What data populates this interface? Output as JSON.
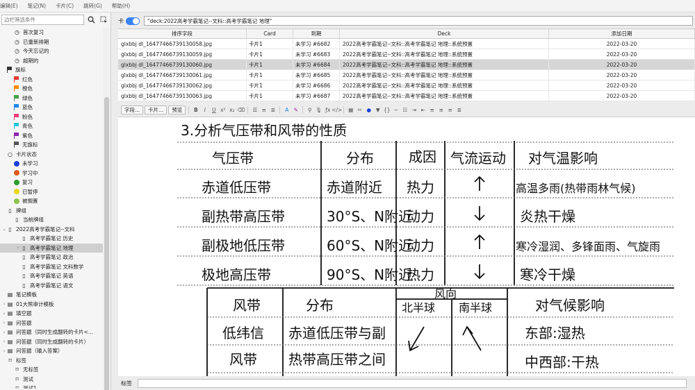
{
  "menu": [
    "编辑(E)",
    "笔记(N)",
    "卡片(C)",
    "跳转(G)",
    "帮助(H)"
  ],
  "sidebar": {
    "search_placeholder": "边栏筛选条件",
    "items": [
      {
        "label": "首次复习",
        "icon": "clock-icon",
        "indent": 1
      },
      {
        "label": "已重新排期",
        "icon": "clock-icon",
        "indent": 1
      },
      {
        "label": "今天忘记的",
        "icon": "clock-icon",
        "indent": 1
      },
      {
        "label": "超期的",
        "icon": "clock-icon",
        "indent": 1
      },
      {
        "label": "旗标",
        "icon": "flag-icon",
        "indent": 0,
        "color": "#333333"
      },
      {
        "label": "红色",
        "icon": "flag-icon",
        "indent": 1,
        "color": "#e53935"
      },
      {
        "label": "橙色",
        "icon": "flag-icon",
        "indent": 1,
        "color": "#fb8c00"
      },
      {
        "label": "绿色",
        "icon": "flag-icon",
        "indent": 1,
        "color": "#43a047"
      },
      {
        "label": "蓝色",
        "icon": "flag-icon",
        "indent": 1,
        "color": "#1e88e5"
      },
      {
        "label": "粉色",
        "icon": "flag-icon",
        "indent": 1,
        "color": "#ec407a"
      },
      {
        "label": "青色",
        "icon": "flag-icon",
        "indent": 1,
        "color": "#26c6da"
      },
      {
        "label": "紫色",
        "icon": "flag-icon",
        "indent": 1,
        "color": "#8e24aa"
      },
      {
        "label": "无旗标",
        "icon": "flag-icon",
        "indent": 1,
        "color": "#555555"
      },
      {
        "label": "卡片状态",
        "icon": "circle-icon",
        "indent": 0
      },
      {
        "label": "未学习",
        "icon": "dot-icon",
        "indent": 1,
        "color": "#1a3fd6"
      },
      {
        "label": "学习中",
        "icon": "dot-icon",
        "indent": 1,
        "color": "#e0581b"
      },
      {
        "label": "复习",
        "icon": "dot-icon",
        "indent": 1,
        "color": "#2e9a2e"
      },
      {
        "label": "已暂停",
        "icon": "dot-icon",
        "indent": 1,
        "color": "#e3d81a"
      },
      {
        "label": "被搁置",
        "icon": "dot-icon",
        "indent": 1,
        "color": "#8bc34a"
      },
      {
        "label": "牌组",
        "icon": "deck-icon",
        "indent": 0
      },
      {
        "label": "当前牌组",
        "icon": "deck-icon",
        "indent": 1
      },
      {
        "label": "2022高考学霸笔记--文科",
        "icon": "deck-icon",
        "indent": 0,
        "arrow": "⌄"
      },
      {
        "label": "高考学霸笔记 历史",
        "icon": "deck-icon",
        "indent": 2
      },
      {
        "label": "高考学霸笔记 地理",
        "icon": "deck-icon",
        "indent": 2,
        "arrow": "›",
        "selected": true
      },
      {
        "label": "高考学霸笔记 政治",
        "icon": "deck-icon",
        "indent": 2
      },
      {
        "label": "高考学霸笔记 文科数学",
        "icon": "deck-icon",
        "indent": 2
      },
      {
        "label": "高考学霸笔记 英语",
        "icon": "deck-icon",
        "indent": 2
      },
      {
        "label": "高考学霸笔记 语文",
        "icon": "deck-icon",
        "indent": 2
      },
      {
        "label": "笔记模板",
        "icon": "notetype-icon",
        "indent": 0
      },
      {
        "label": "01大熊审计模板",
        "icon": "notetype-icon",
        "indent": 0,
        "arrow": "›"
      },
      {
        "label": "填空题",
        "icon": "notetype-icon",
        "indent": 0,
        "arrow": "›"
      },
      {
        "label": "问答题",
        "icon": "notetype-icon",
        "indent": 0,
        "arrow": "›"
      },
      {
        "label": "问答题（同时生成翻转的卡片<…",
        "icon": "notetype-icon",
        "indent": 0,
        "arrow": "›"
      },
      {
        "label": "问答题（同时生成翻转的卡片）",
        "icon": "notetype-icon",
        "indent": 0,
        "arrow": "›"
      },
      {
        "label": "问答题（输入答案）",
        "icon": "notetype-icon",
        "indent": 0,
        "arrow": "›"
      },
      {
        "label": "标签",
        "icon": "tag-icon",
        "indent": 0
      },
      {
        "label": "无标签",
        "icon": "tag-icon",
        "indent": 1
      },
      {
        "label": "测试",
        "icon": "tag-icon",
        "indent": 1
      },
      {
        "label": "测试1",
        "icon": "tag-icon",
        "indent": 1
      }
    ]
  },
  "search": {
    "toggle_label": "卡",
    "query": "\"deck:2022高考学霸笔记--文科::高考学霸笔记 地理\""
  },
  "table": {
    "headers": [
      "排序字段",
      "Card",
      "到期",
      "Deck",
      "添加日期"
    ],
    "rows": [
      [
        "glxbbj dl_16477466739130058.jpg",
        "卡片1",
        "未学习 #6682",
        "2022高考学霸笔记--文科::高考学霸笔记 地理::系统预置",
        "2022-03-20"
      ],
      [
        "glxbbj dl_16477466739130059.jpg",
        "卡片1",
        "未学习 #6683",
        "2022高考学霸笔记--文科::高考学霸笔记 地理::系统预置",
        "2022-03-20"
      ],
      [
        "glxbbj dl_16477466739130060.jpg",
        "卡片1",
        "未学习 #6684",
        "2022高考学霸笔记--文科::高考学霸笔记 地理::系统预置",
        "2022-03-20"
      ],
      [
        "glxbbj dl_16477466739130061.jpg",
        "卡片1",
        "未学习 #6685",
        "2022高考学霸笔记--文科::高考学霸笔记 地理::系统预置",
        "2022-03-20"
      ],
      [
        "glxbbj dl_16477466739130062.jpg",
        "卡片1",
        "未学习 #6686",
        "2022高考学霸笔记--文科::高考学霸笔记 地理::系统预置",
        "2022-03-20"
      ],
      [
        "glxbbj dl_16477466739130063.jpg",
        "卡片1",
        "未学习 #6687",
        "2022高考学霸笔记--文科::高考学霸笔记 地理::系统预置",
        "2022-03-20"
      ]
    ],
    "selected_row": 2
  },
  "toolbar": {
    "fields_button": "字段...",
    "cards_button": "卡片...",
    "preview_button": "预览"
  },
  "note": {
    "title": "3.分析气压带和风带的性质",
    "pressure_headers": [
      "气压带",
      "分布",
      "成因",
      "气流运动",
      "对气温影响"
    ],
    "pressure_rows": [
      [
        "赤道低压带",
        "赤道附近",
        "热力",
        "↑",
        "高温多雨(热带雨林气候)"
      ],
      [
        "副热带高压带",
        "30°S、N附近",
        "动力",
        "↓",
        "炎热干燥"
      ],
      [
        "副极地低压带",
        "60°S、N附近",
        "动力",
        "↑",
        "寒冷湿润、多锋面雨、气旋雨"
      ],
      [
        "极地高压带",
        "90°S、N附近",
        "热力",
        "↓",
        "寒冷干燥"
      ]
    ],
    "wind_headers": [
      "风带",
      "分布",
      "风向",
      "北半球",
      "南半球",
      "对气候影响"
    ],
    "wind_rows": [
      [
        "低纬信",
        "赤道低压带与副",
        "东部:湿热"
      ],
      [
        "风带",
        "热带高压带之间",
        "中西部:干热"
      ]
    ]
  },
  "tags_label": "标签"
}
